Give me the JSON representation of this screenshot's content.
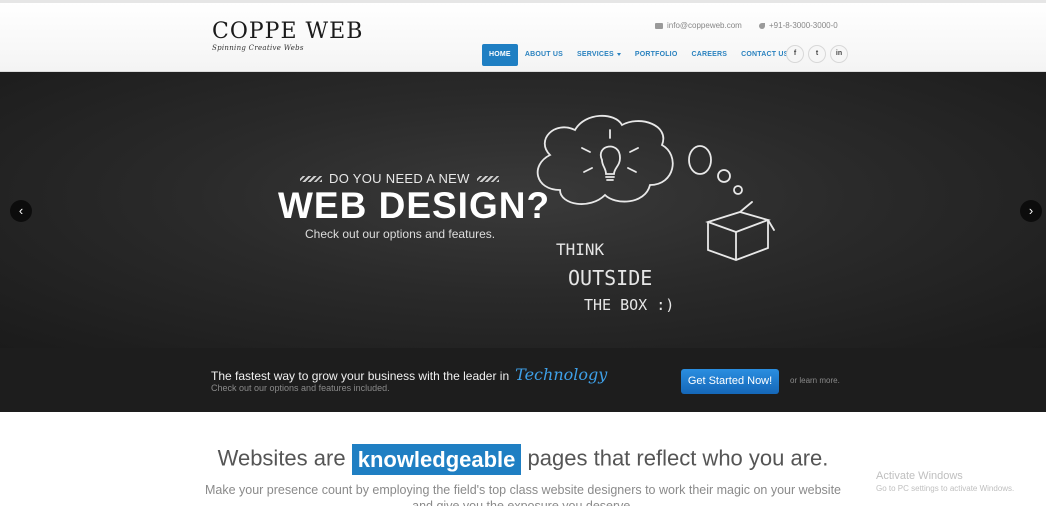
{
  "header": {
    "logo_text": "COPPE WEB",
    "logo_tagline": "Spinning Creative Webs",
    "email": "info@coppeweb.com",
    "phone": "+91-8-3000-3000-0",
    "nav": [
      {
        "label": "HOME",
        "active": true
      },
      {
        "label": "ABOUT US"
      },
      {
        "label": "SERVICES"
      },
      {
        "label": "PORTFOLIO"
      },
      {
        "label": "CAREERS"
      },
      {
        "label": "CONTACT US"
      }
    ],
    "social": [
      {
        "icon": "facebook-icon",
        "glyph": "f"
      },
      {
        "icon": "twitter-icon",
        "glyph": "t"
      },
      {
        "icon": "linkedin-icon",
        "glyph": "in"
      }
    ]
  },
  "hero": {
    "eyebrow": "DO YOU NEED A NEW",
    "headline": "WEB DESIGN?",
    "subtext": "Check out our options and features.",
    "chalk_line1": "THINK",
    "chalk_line2": "OUTSIDE",
    "chalk_line3": "THE BOX :)",
    "prev_glyph": "‹",
    "next_glyph": "›"
  },
  "strip": {
    "text": "The fastest way to grow your business with the leader in",
    "highlight": "Technology",
    "subtext": "Check out our options and features included.",
    "cta_label": "Get Started Now!",
    "learn_more": "or learn more."
  },
  "content": {
    "title_before": "Websites are",
    "title_keyword": "knowledgeable",
    "title_after": "pages that reflect who you are.",
    "subtext": "Make your presence count by employing the field's top class website designers to work their magic on your website and give you the exposure you deserve."
  },
  "os_overlay": {
    "title": "Activate Windows",
    "subtitle": "Go to PC settings to activate Windows."
  },
  "colors": {
    "accent": "#1f7fc3",
    "hero_bg": "#2a2a2a",
    "strip_bg": "#1d1d1d",
    "highlight": "#3ea0e8"
  }
}
